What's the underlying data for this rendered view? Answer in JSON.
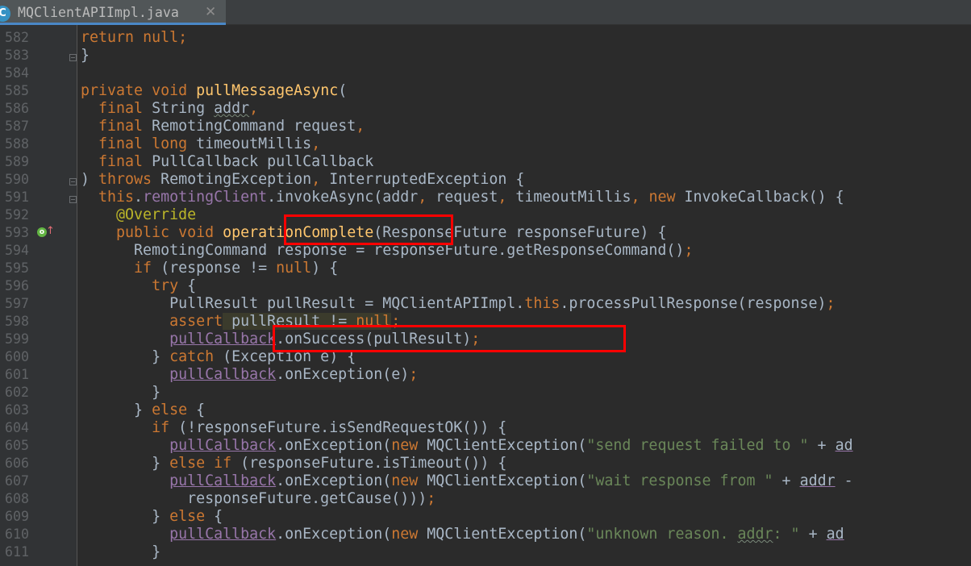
{
  "tab": {
    "title": "MQClientAPIImpl.java",
    "icon": "C",
    "close": "✕",
    "icon_name": "java-class-icon"
  },
  "colors": {
    "background": "#2b2b2b",
    "keyword": "#cc7832",
    "method": "#ffc66d",
    "field": "#9876aa",
    "string": "#6a8759",
    "annotation": "#bbb529",
    "plain": "#a9b7c6",
    "highlight_box": "#ff0000"
  },
  "line_numbers": [
    "582",
    "583",
    "584",
    "585",
    "586",
    "587",
    "588",
    "589",
    "590",
    "591",
    "592",
    "593",
    "594",
    "595",
    "596",
    "597",
    "598",
    "599",
    "600",
    "601",
    "602",
    "603",
    "604",
    "605",
    "606",
    "607",
    "608",
    "609",
    "610",
    "611"
  ],
  "code": {
    "l582": {
      "ret": "return",
      "nul": "null",
      "semi": ";"
    },
    "l583": {
      "brace": "}"
    },
    "l585": {
      "priv": "private",
      "void": "void",
      "name": "pullMessageAsync",
      "paren": "("
    },
    "l586": {
      "fin": "final",
      "rest": "String ",
      "param": "addr",
      "comma": ","
    },
    "l587": {
      "fin": "final",
      "rest": "RemotingCommand request",
      "comma": ","
    },
    "l588": {
      "fin": "final",
      "lng": "long",
      "rest": " timeoutMillis",
      "comma": ","
    },
    "l589": {
      "fin": "final",
      "rest": "PullCallback pullCallback"
    },
    "l590": {
      "a": ") ",
      "thr": "throws",
      "b": " RemotingException",
      "c": ",",
      "d": " InterruptedException {"
    },
    "l591": {
      "ths": "this",
      "dot": ".",
      "fld": "remotingClient",
      "a": ".invokeAsync(addr",
      "c1": ",",
      "b": " request",
      "c2": ",",
      "c": " timeoutMillis",
      "c3": ",",
      "nw": "new",
      "d": " InvokeCallback() {"
    },
    "l592": {
      "ann": "@Override"
    },
    "l593": {
      "pub": "public",
      "void": "void",
      "name": "operationComplete",
      "rest": "(ResponseFuture responseFuture) {"
    },
    "l594": {
      "a": "RemotingCommand response = responseFuture.getResponseCommand()",
      "semi": ";"
    },
    "l595": {
      "iff": "if",
      "a": " (response != ",
      "nul": "null",
      "b": ") {"
    },
    "l596": {
      "tr": "try",
      "a": " {"
    },
    "l597": {
      "a": "PullResult pullResult = MQClientAPIImpl.",
      "ths": "this",
      "b": ".processPullResponse(response)",
      "semi": ";"
    },
    "l598": {
      "asrt": "assert",
      "a": " pullResult != ",
      "nul": "null",
      "semi": ";"
    },
    "l599": {
      "cb": "pullCallback",
      "a": ".onSuccess(pullResult)",
      "semi": ";"
    },
    "l600": {
      "a": "} ",
      "ctch": "catch",
      "b": " (Exception e) {"
    },
    "l601": {
      "cb": "pullCallback",
      "a": ".onException(e)",
      "semi": ";"
    },
    "l602": {
      "brace": "}"
    },
    "l603": {
      "a": "} ",
      "els": "else",
      "b": " {"
    },
    "l604": {
      "iff": "if",
      "a": " (!responseFuture.isSendRequestOK()) {"
    },
    "l605": {
      "cb": "pullCallback",
      "a": ".onException(",
      "nw": "new",
      "b": " MQClientException(",
      "str": "\"send request failed to \"",
      "c": " + ",
      "tail": "ad"
    },
    "l606": {
      "a": "} ",
      "els": "else",
      "sp": " ",
      "iff": "if",
      "b": " (responseFuture.isTimeout()) {"
    },
    "l607": {
      "cb": "pullCallback",
      "a": ".onException(",
      "nw": "new",
      "b": " MQClientException(",
      "str": "\"wait response from \"",
      "c": " + ",
      "tail": "addr",
      "d": " -"
    },
    "l608": {
      "a": "responseFuture.getCause()))",
      "semi": ";"
    },
    "l609": {
      "a": "} ",
      "els": "else",
      "b": " {"
    },
    "l610": {
      "cb": "pullCallback",
      "a": ".onException(",
      "nw": "new",
      "b": " MQClientException(",
      "str1": "\"unknown reason. ",
      "sq": "addr",
      "str2": ": \"",
      "c": " + ",
      "tail": "ad"
    },
    "l611": {
      "brace": "}"
    }
  }
}
